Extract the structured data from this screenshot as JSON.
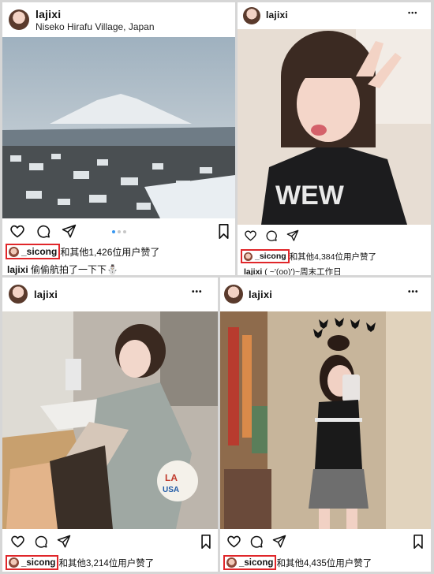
{
  "posts": [
    {
      "username": "lajixi",
      "location": "Niseko Hirafu Village, Japan",
      "more": "•••",
      "liker": "_sicong",
      "likes_text": "和其他1,426位用户赞了",
      "caption_user": "lajixi",
      "caption_text": "偷偷航拍了一下下⛄"
    },
    {
      "username": "lajixi",
      "more": "•••",
      "liker": "_sicong",
      "likes_text": "和其他4,384位用户赞了",
      "caption_user": "lajixi",
      "caption_text": "( ~'(oo)')~周末工作日"
    },
    {
      "username": "lajixi",
      "more": "•••",
      "liker": "_sicong",
      "likes_text": "和其他3,214位用户赞了"
    },
    {
      "username": "lajixi",
      "more": "•••",
      "liker": "_sicong",
      "likes_text": "和其他4,435位用户赞了"
    }
  ],
  "colors": {
    "highlight": "#e0262a",
    "carousel_active": "#3897f0"
  }
}
